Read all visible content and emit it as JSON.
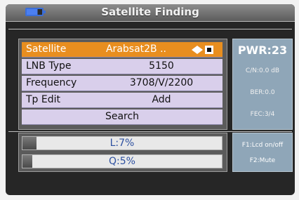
{
  "header": {
    "title": "Satellite Finding",
    "icon": "battery-icon"
  },
  "menu": {
    "rows": [
      {
        "label": "Satellite",
        "value": "Arabsat2B .."
      },
      {
        "label": "LNB Type",
        "value": "5150"
      },
      {
        "label": "Frequency",
        "value": "3708/V/2200"
      },
      {
        "label": "Tp Edit",
        "value": "Add"
      }
    ],
    "search_label": "Search"
  },
  "info": {
    "pwr": "PWR:23",
    "cn": "C/N:0.0 dB",
    "ber": "BER:0.0",
    "fec": "FEC:3/4"
  },
  "signal": {
    "level_label": "L:7%",
    "level_value": 7,
    "quality_label": "Q:5%",
    "quality_value": 5
  },
  "keys": {
    "f1": "F1:Lcd on/off",
    "f2": "F2:Mute"
  },
  "colors": {
    "highlight": "#e88e1f",
    "row": "#d9cfeb",
    "info": "#8fa6b8"
  }
}
